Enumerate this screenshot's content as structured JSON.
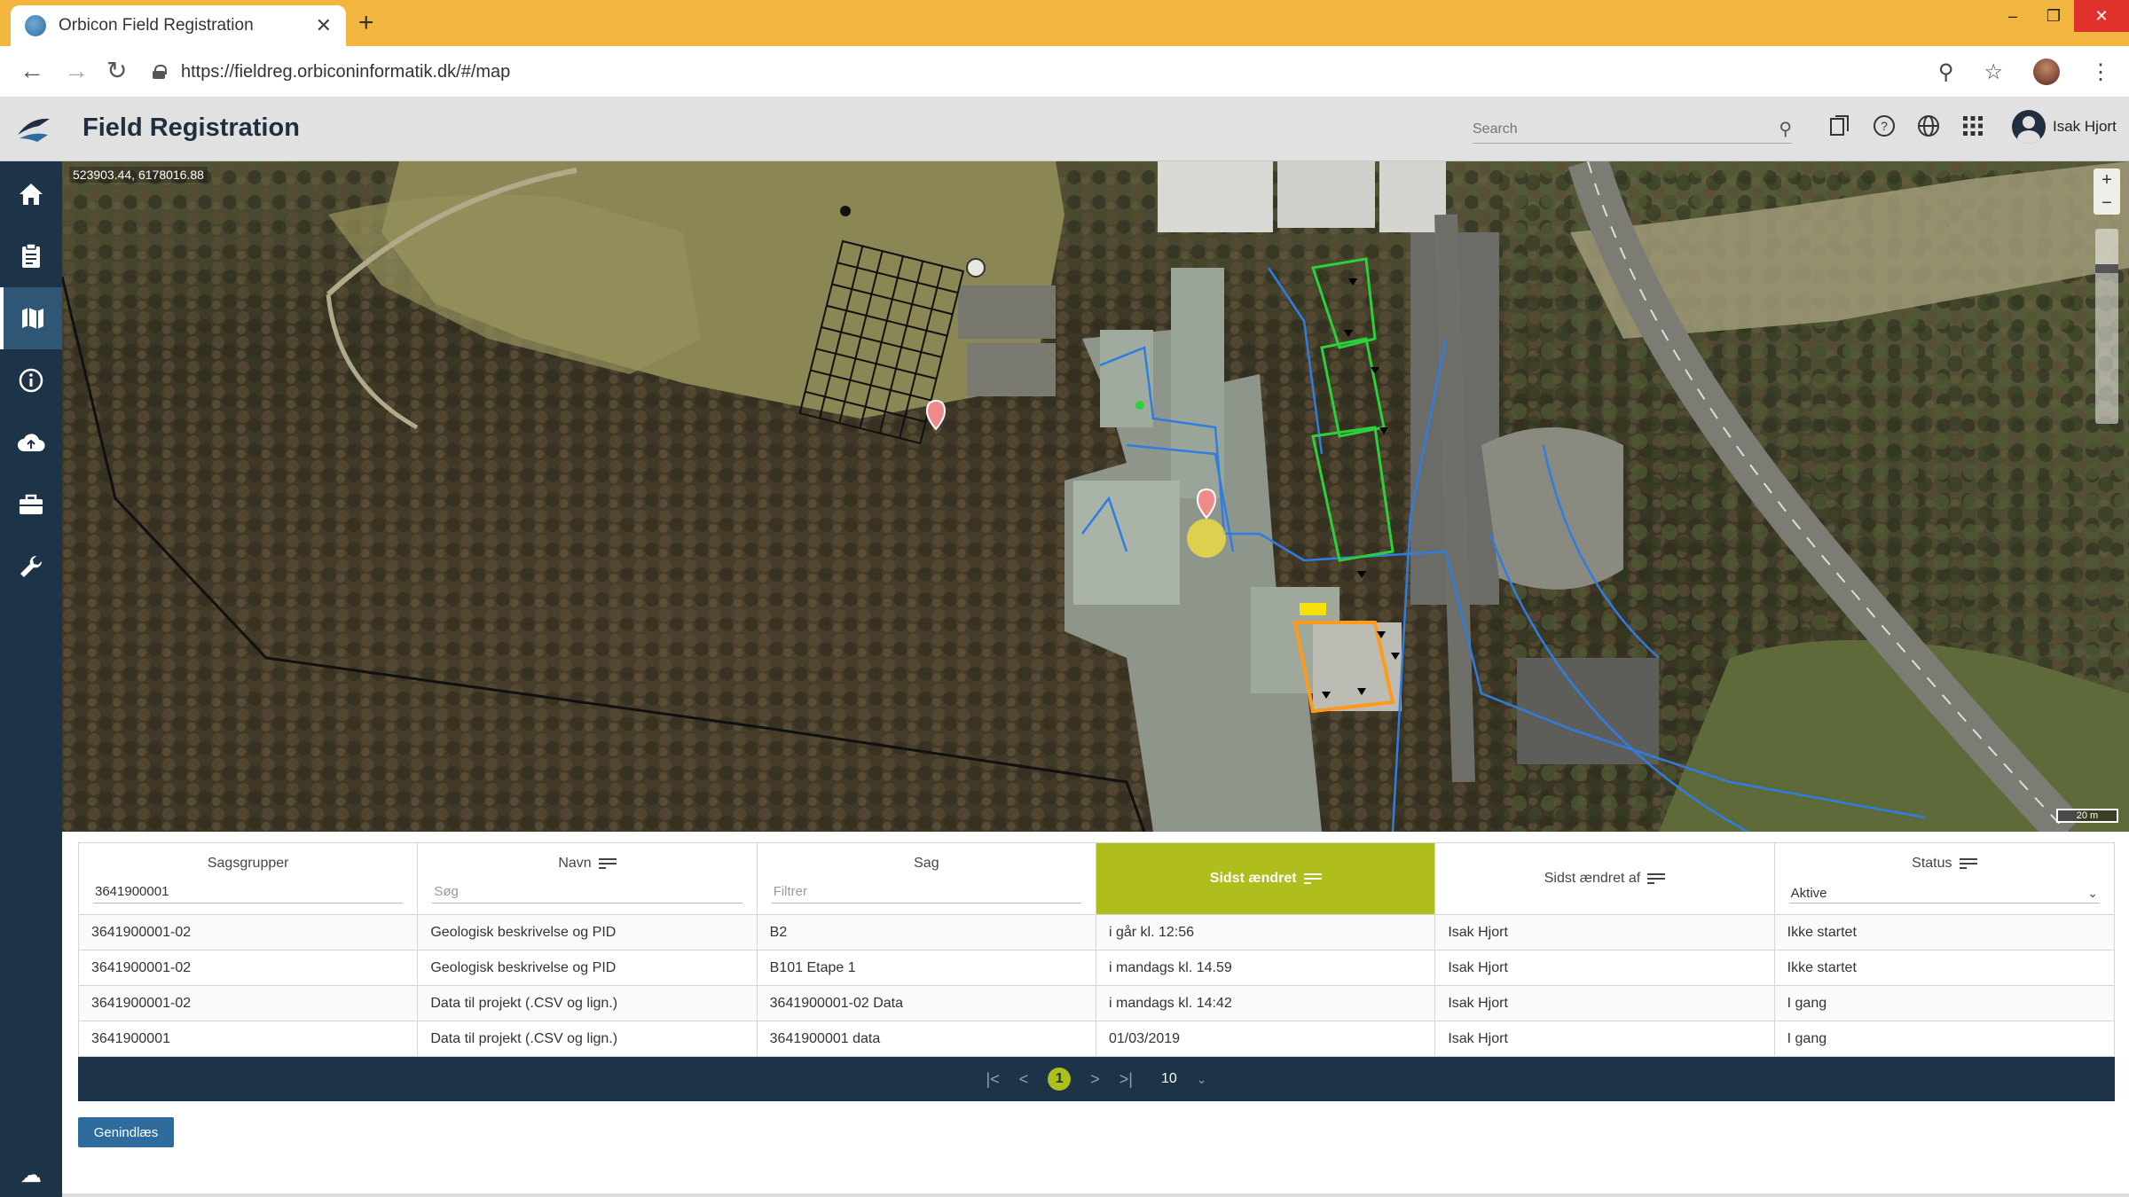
{
  "browser": {
    "tab_title": "Orbicon Field Registration",
    "tab_close": "✕",
    "new_tab": "+",
    "url": "https://fieldreg.orbiconinformatik.dk/#/map",
    "window_controls": {
      "minimize": "–",
      "maximize": "❐",
      "close": "✕"
    }
  },
  "app": {
    "title": "Field Registration",
    "search_placeholder": "Search",
    "user_name": "Isak Hjort",
    "header_icons": [
      "copy-icon",
      "help-icon",
      "globe-icon",
      "apps-grid-icon"
    ]
  },
  "sidebar": {
    "items": [
      {
        "name": "home",
        "icon": "⌂"
      },
      {
        "name": "clipboard",
        "icon": "▤"
      },
      {
        "name": "map",
        "icon": "▥",
        "active": true
      },
      {
        "name": "info",
        "icon": "ⓘ"
      },
      {
        "name": "cloud",
        "icon": "☁"
      },
      {
        "name": "briefcase",
        "icon": "▣"
      },
      {
        "name": "wrench",
        "icon": "✎"
      }
    ]
  },
  "map": {
    "coordinates": "523903.44, 6178016.88",
    "zoom_in": "+",
    "zoom_out": "−",
    "scale": "20 m"
  },
  "table": {
    "columns": [
      {
        "label": "Sagsgrupper",
        "filter": "3641900001",
        "filter_is_placeholder": false,
        "sortable": false
      },
      {
        "label": "Navn",
        "filter": "Søg",
        "filter_is_placeholder": true,
        "sortable": true
      },
      {
        "label": "Sag",
        "filter": "Filtrer",
        "filter_is_placeholder": true,
        "sortable": false
      },
      {
        "label": "Sidst ændret",
        "sorted": true,
        "sortable": true
      },
      {
        "label": "Sidst ændret af",
        "sortable": true
      },
      {
        "label": "Status",
        "filter": "Aktive",
        "sortable": true
      }
    ],
    "rows": [
      [
        "3641900001-02",
        "Geologisk beskrivelse og PID",
        "B2",
        "i går kl. 12:56",
        "Isak Hjort",
        "Ikke startet"
      ],
      [
        "3641900001-02",
        "Geologisk beskrivelse og PID",
        "B101 Etape 1",
        "i mandags kl. 14.59",
        "Isak Hjort",
        "Ikke startet"
      ],
      [
        "3641900001-02",
        "Data til projekt (.CSV og lign.)",
        "3641900001-02 Data",
        "i mandags kl. 14:42",
        "Isak Hjort",
        "I gang"
      ],
      [
        "3641900001",
        "Data til projekt (.CSV og lign.)",
        "3641900001 data",
        "01/03/2019",
        "Isak Hjort",
        "I gang"
      ]
    ],
    "pager": {
      "first": "|<",
      "prev": "<",
      "current_page": "1",
      "next": ">",
      "last": ">|",
      "page_size": "10"
    }
  },
  "actions": {
    "reload_label": "Genindlæs"
  },
  "colors": {
    "accent": "#afbd1d",
    "sidebar": "#1c3348",
    "tabbar": "#f2b640",
    "button": "#2f6c9e"
  }
}
